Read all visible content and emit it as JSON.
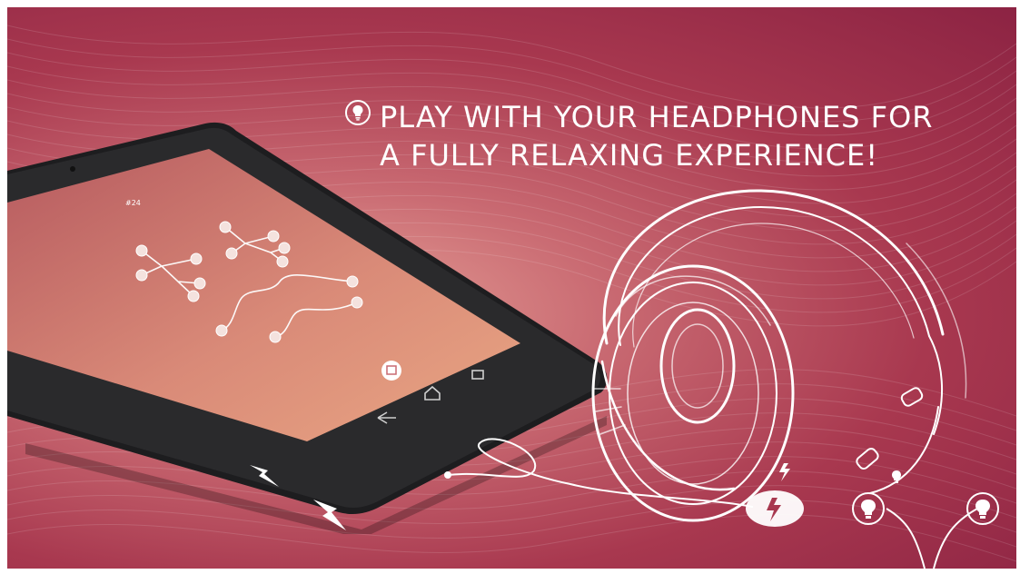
{
  "headline": {
    "line1": "PLAY WITH YOUR HEADPHONES FOR",
    "line2": "A FULLY RELAXING EXPERIENCE!"
  },
  "game_screen": {
    "level_label": "#24"
  },
  "icons": [
    "lightbulb-icon",
    "headphones-illustration",
    "lightning-bolt-icon",
    "back-nav-icon",
    "home-nav-icon",
    "recents-nav-icon",
    "share-icon"
  ],
  "colors": {
    "accent": "#a8384f",
    "background_dark": "#8c2343",
    "glow": "#e8a59a",
    "white": "#ffffff"
  }
}
